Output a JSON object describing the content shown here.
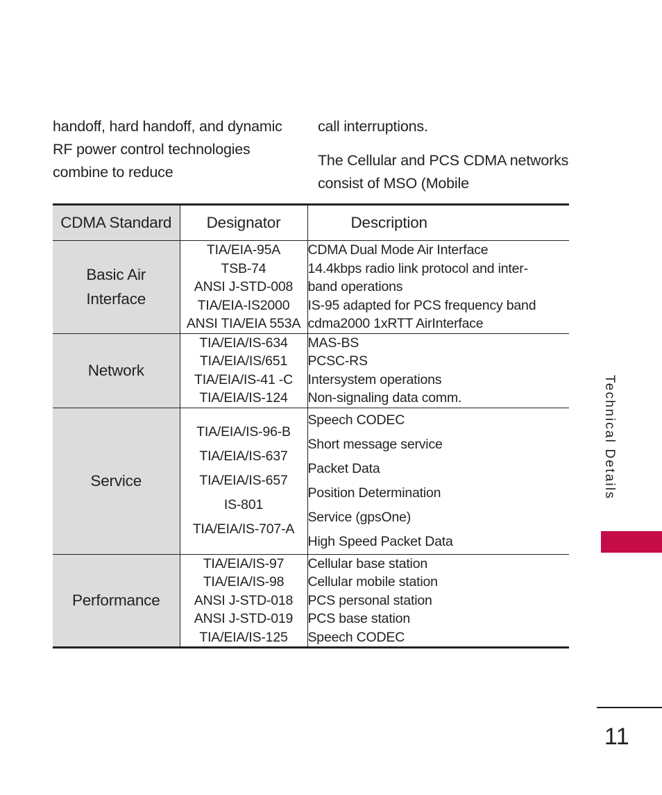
{
  "document": {
    "page_number": "11",
    "side_tab_label": "Technical Details",
    "accent_color": "#c60c46",
    "category_bg_color": "#dcdcdc",
    "text_color": "#231f20"
  },
  "prose": {
    "left_column": [
      "handoff, hard handoff, and dynamic RF power control technologies combine to reduce"
    ],
    "right_column": [
      "call interruptions.",
      "The Cellular and PCS CDMA networks consist of MSO (Mobile"
    ]
  },
  "table": {
    "headers": {
      "standard": "CDMA Standard",
      "designator": "Designator",
      "description": "Description"
    },
    "rows": [
      {
        "category": "Basic Air\nInterface",
        "designators": [
          "TIA/EIA-95A",
          "TSB-74",
          "ANSI J-STD-008",
          "TIA/EIA-IS2000",
          "ANSI TIA/EIA 553A"
        ],
        "descriptions": [
          "CDMA Dual Mode Air Interface",
          "14.4kbps radio link protocol and inter-",
          "band operations",
          "IS-95 adapted for PCS frequency band",
          "cdma2000 1xRTT AirInterface"
        ]
      },
      {
        "category": "Network",
        "designators": [
          "TIA/EIA/IS-634",
          "TIA/EIA/IS/651",
          "TIA/EIA/IS-41 -C",
          "TIA/EIA/IS-124"
        ],
        "descriptions": [
          "MAS-BS",
          "PCSC-RS",
          "Intersystem operations",
          "Non-signaling data comm."
        ]
      },
      {
        "category": "Service",
        "designators": [
          "TIA/EIA/IS-96-B",
          "TIA/EIA/IS-637",
          "TIA/EIA/IS-657",
          "IS-801",
          "TIA/EIA/IS-707-A"
        ],
        "descriptions": [
          "Speech CODEC",
          "Short message service",
          "Packet Data",
          "Position Determination",
          "Service (gpsOne)",
          "High Speed Packet Data"
        ]
      },
      {
        "category": "Performance",
        "designators": [
          "TIA/EIA/IS-97",
          "TIA/EIA/IS-98",
          "ANSI J-STD-018",
          "ANSI J-STD-019",
          "TIA/EIA/IS-125"
        ],
        "descriptions": [
          "Cellular base station",
          "Cellular mobile station",
          "PCS personal station",
          "PCS base station",
          "Speech CODEC"
        ]
      }
    ]
  }
}
